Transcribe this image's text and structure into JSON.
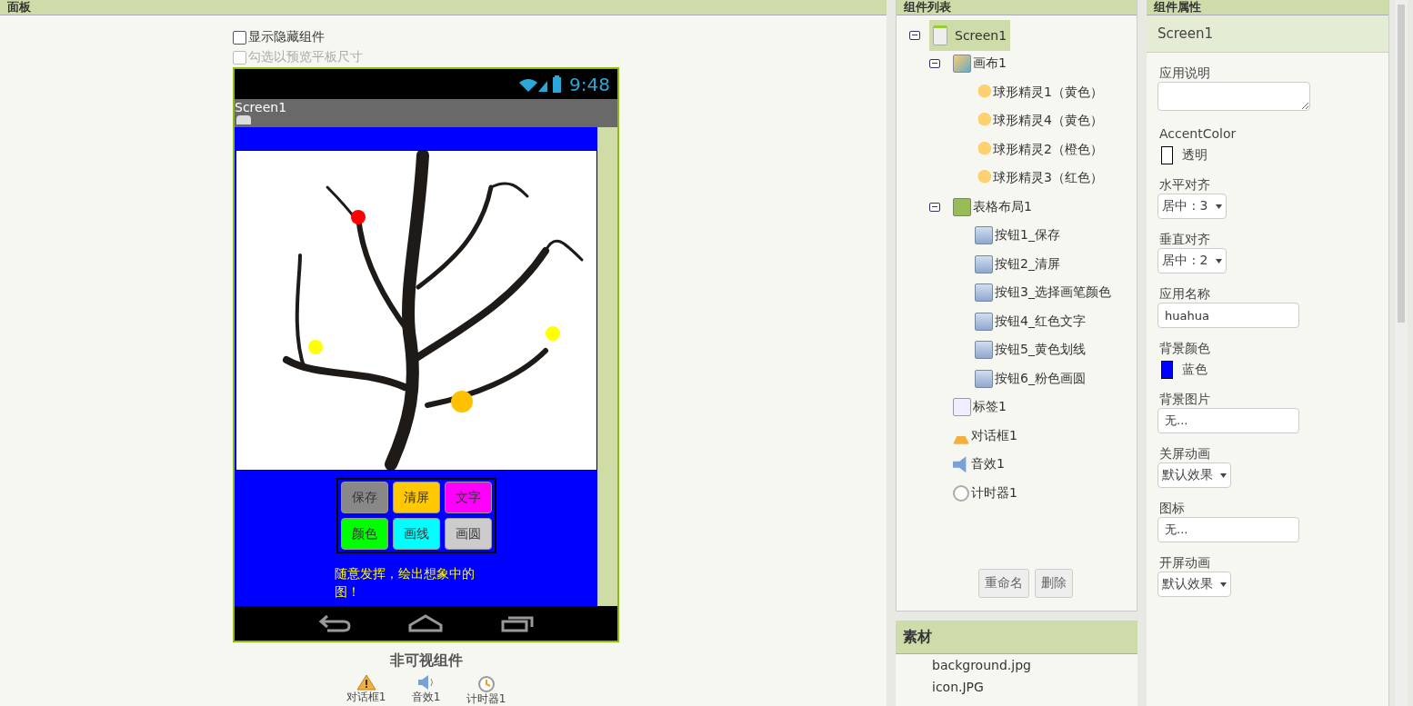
{
  "viewer": {
    "header": "面板",
    "checkboxes": [
      {
        "label": "显示隐藏组件",
        "checked": false,
        "disabled": false
      },
      {
        "label": "勾选以预览平板尺寸",
        "checked": false,
        "disabled": true
      }
    ],
    "phone": {
      "time": "9:48",
      "title": "Screen1",
      "canvas": {
        "sprites": [
          {
            "color": "#ff0000"
          },
          {
            "color": "#ffff00"
          },
          {
            "color": "#ffff00"
          },
          {
            "color": "#ffc000"
          }
        ]
      },
      "buttons": [
        {
          "label": "保存",
          "color": "#888888"
        },
        {
          "label": "清屏",
          "color": "#ffc800"
        },
        {
          "label": "文字",
          "color": "#ff00ff"
        },
        {
          "label": "颜色",
          "color": "#00ff00"
        },
        {
          "label": "画线",
          "color": "#00ffff"
        },
        {
          "label": "画圆",
          "color": "#cccccc"
        }
      ],
      "label": "随意发挥，绘出想象中的图！"
    },
    "nonvisible": {
      "title": "非可视组件",
      "items": [
        {
          "kind": "notifier",
          "label": "对话框1"
        },
        {
          "kind": "sound",
          "label": "音效1"
        },
        {
          "kind": "clock",
          "label": "计时器1"
        }
      ]
    }
  },
  "components": {
    "header": "组件列表",
    "tree": [
      {
        "kind": "screen",
        "label": "Screen1",
        "selected": true,
        "expanded": true,
        "children": [
          {
            "kind": "canvas",
            "label": "画布1",
            "selected": false,
            "expanded": true,
            "children": [
              {
                "kind": "sprite",
                "label": "球形精灵1（黄色）",
                "selected": false
              },
              {
                "kind": "sprite",
                "label": "球形精灵4（黄色）",
                "selected": false
              },
              {
                "kind": "sprite",
                "label": "球形精灵2（橙色）",
                "selected": false
              },
              {
                "kind": "sprite",
                "label": "球形精灵3（红色）",
                "selected": false
              }
            ]
          },
          {
            "kind": "table",
            "label": "表格布局1",
            "selected": false,
            "expanded": true,
            "children": [
              {
                "kind": "button",
                "label": "按钮1_保存",
                "selected": false
              },
              {
                "kind": "button",
                "label": "按钮2_清屏",
                "selected": false
              },
              {
                "kind": "button",
                "label": "按钮3_选择画笔颜色",
                "selected": false
              },
              {
                "kind": "button",
                "label": "按钮4_红色文字",
                "selected": false
              },
              {
                "kind": "button",
                "label": "按钮5_黄色划线",
                "selected": false
              },
              {
                "kind": "button",
                "label": "按钮6_粉色画圆",
                "selected": false
              }
            ]
          },
          {
            "kind": "label",
            "label": "标签1",
            "selected": false
          },
          {
            "kind": "notifier",
            "label": "对话框1",
            "selected": false
          },
          {
            "kind": "sound",
            "label": "音效1",
            "selected": false
          },
          {
            "kind": "clock",
            "label": "计时器1",
            "selected": false
          }
        ]
      }
    ],
    "buttons": [
      "重命名",
      "删除"
    ]
  },
  "media": {
    "header": "素材",
    "files": [
      "background.jpg",
      "icon.JPG"
    ]
  },
  "properties": {
    "header": "组件属性",
    "component": "Screen1",
    "items": [
      {
        "kind": "textarea",
        "label": "应用说明"
      },
      {
        "kind": "color",
        "label": "AccentColor",
        "value": "透明",
        "color": "#ffffff"
      },
      {
        "kind": "select",
        "label": "水平对齐",
        "value": "居中 : 3"
      },
      {
        "kind": "select",
        "label": "垂直对齐",
        "value": "居中 : 2"
      },
      {
        "kind": "input",
        "label": "应用名称",
        "value": "huahua"
      },
      {
        "kind": "color",
        "label": "背景颜色",
        "value": "蓝色",
        "color": "#0000ff"
      },
      {
        "kind": "input",
        "label": "背景图片",
        "value": "无..."
      },
      {
        "kind": "select",
        "label": "关屏动画",
        "value": "默认效果"
      },
      {
        "kind": "input",
        "label": "图标",
        "value": "无..."
      },
      {
        "kind": "select",
        "label": "开屏动画",
        "value": "默认效果"
      }
    ]
  }
}
